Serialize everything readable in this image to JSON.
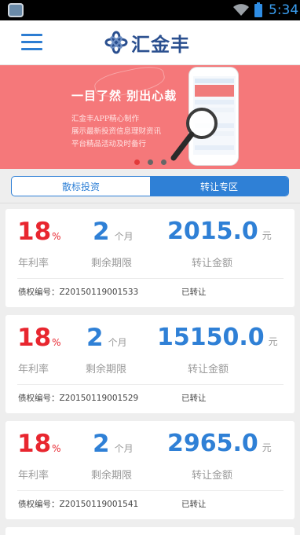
{
  "status_bar": {
    "time": "5:34"
  },
  "header": {
    "brand": "汇金丰"
  },
  "banner": {
    "slogan": "一目了然 别出心裁",
    "desc_lines": [
      "汇金丰APP精心制作",
      "展示最新投资信息理财资讯",
      "平台精品活动及时备行"
    ],
    "dots": 3,
    "active_dot": 0
  },
  "tabs": [
    {
      "label": "散标投资",
      "active": false
    },
    {
      "label": "转让专区",
      "active": true
    }
  ],
  "labels": {
    "rate": "年利率",
    "term": "剩余期限",
    "amount": "转让金额",
    "percent_unit": "%",
    "term_unit": "个月",
    "amount_unit": "元"
  },
  "items": [
    {
      "rate": "18",
      "term": "2",
      "amount": "2015.0",
      "bond_no": "债权编号：Z20150119001533",
      "status": "已转让"
    },
    {
      "rate": "18",
      "term": "2",
      "amount": "15150.0",
      "bond_no": "债权编号：Z20150119001529",
      "status": "已转让"
    },
    {
      "rate": "18",
      "term": "2",
      "amount": "2965.0",
      "bond_no": "债权编号：Z20150119001541",
      "status": "已转让"
    }
  ],
  "colors": {
    "brand_blue": "#2f80d6",
    "rate_red": "#e8262f",
    "banner_bg": "#f5787a"
  }
}
